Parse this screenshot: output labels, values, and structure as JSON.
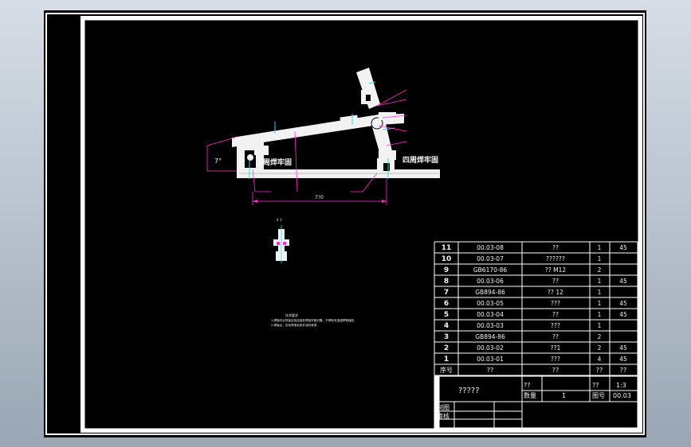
{
  "colors": {
    "background": "#000000",
    "frame": "#ffffff",
    "part": "#f2f2f2",
    "dimension": "#ff33cc",
    "centerline": "#33dddd",
    "table_line": "#ffffff"
  },
  "drawing": {
    "weld_note_left": "四周焊牢固",
    "weld_note_right": "四周焊牢固",
    "angle_label": "7°",
    "length_label": "7?0",
    "small_label": "4  1",
    "tech_notes_title": "技术要求",
    "tech_notes_line1": "1.焊接时必须保证各连接处焊接牢固可靠，不得有夹渣虚焊等缺陷",
    "tech_notes_line2": "2.焊接后，去除焊渣毛刺并涂防锈漆。"
  },
  "parts_table": {
    "rows": [
      {
        "no": "11",
        "code": "00.03-08",
        "name": "??",
        "qty": "1",
        "mat": "45"
      },
      {
        "no": "10",
        "code": "00.03-07",
        "name": "??????",
        "qty": "1",
        "mat": ""
      },
      {
        "no": "9",
        "code": "GB6170-86",
        "name": "??  M12",
        "qty": "2",
        "mat": ""
      },
      {
        "no": "8",
        "code": "00.03-06",
        "name": "??",
        "qty": "1",
        "mat": "45"
      },
      {
        "no": "7",
        "code": "GB894-86",
        "name": "??  12",
        "qty": "1",
        "mat": ""
      },
      {
        "no": "6",
        "code": "00.03-05",
        "name": "???",
        "qty": "1",
        "mat": "45"
      },
      {
        "no": "5",
        "code": "00.03-04",
        "name": "??",
        "qty": "1",
        "mat": "45"
      },
      {
        "no": "4",
        "code": "00.03-03",
        "name": "???",
        "qty": "1",
        "mat": ""
      },
      {
        "no": "3",
        "code": "GB894-86",
        "name": "??",
        "qty": "2",
        "mat": ""
      },
      {
        "no": "2",
        "code": "00.03-02",
        "name": "??1",
        "qty": "2",
        "mat": "45"
      },
      {
        "no": "1",
        "code": "00.03-01",
        "name": "???",
        "qty": "4",
        "mat": "45"
      }
    ],
    "header": {
      "no": "序号",
      "code": "??",
      "name": "??",
      "qty": "??",
      "mat": "??"
    }
  },
  "title_block": {
    "title": "?????",
    "scale_label": "??",
    "scale_value": "1:3",
    "quantity_label": "数量",
    "quantity_value": "1",
    "material_label": "??",
    "drawing_label": "图号",
    "drawing_no": "00.03",
    "designed_label": "制图",
    "checked_label": "审核"
  }
}
